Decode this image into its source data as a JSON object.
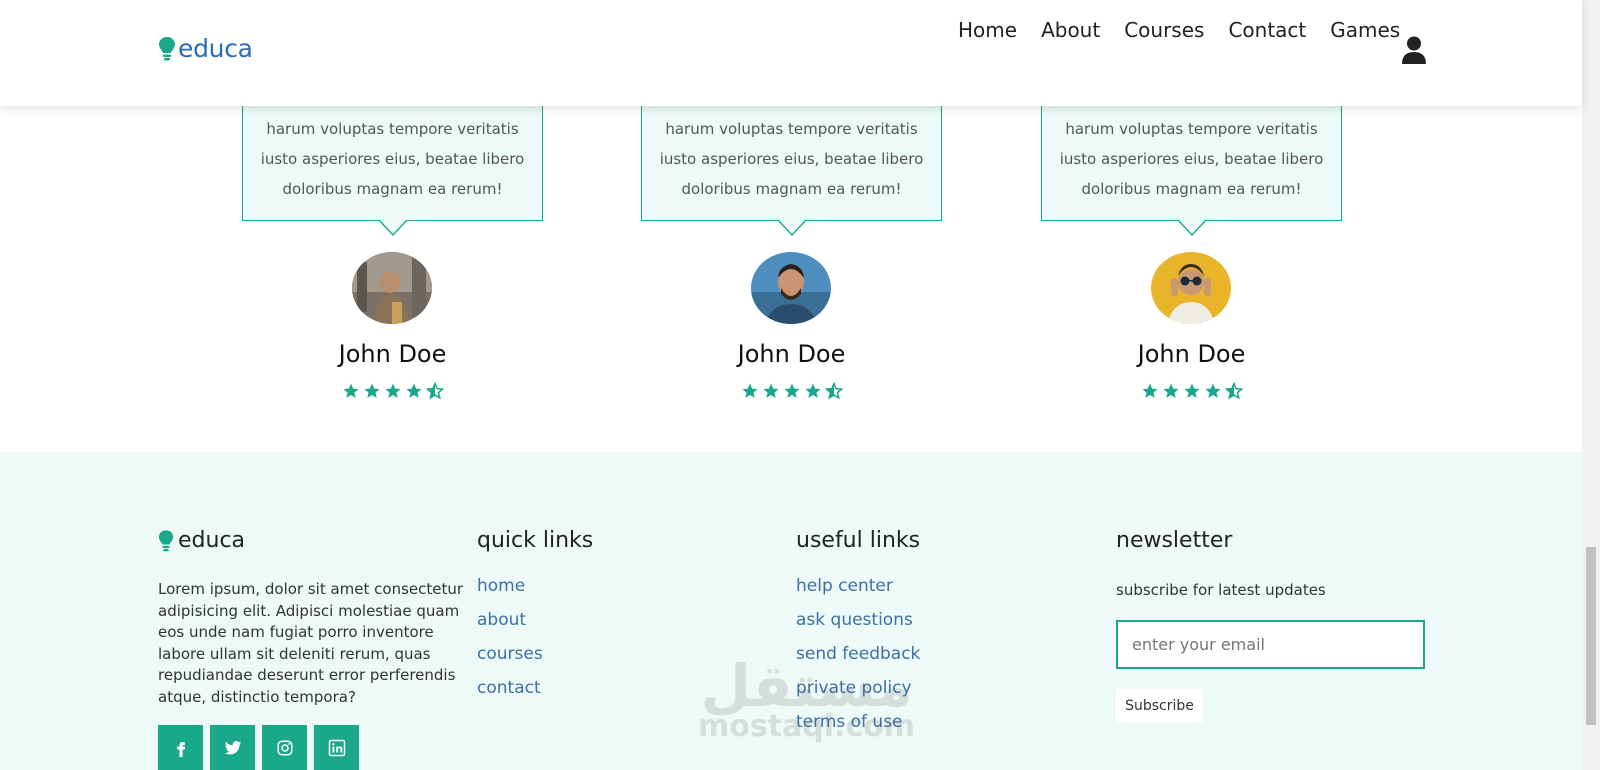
{
  "header": {
    "logo_text": "educa",
    "nav": [
      "Home",
      "About",
      "Courses",
      "Contact",
      "Games"
    ]
  },
  "testimonials": [
    {
      "text_lines": [
        "harum voluptas tempore veritatis",
        "iusto asperiores eius, beatae libero",
        "doloribus magnam ea rerum!"
      ],
      "name": "John Doe",
      "rating": 4.5
    },
    {
      "text_lines": [
        "harum voluptas tempore veritatis",
        "iusto asperiores eius, beatae libero",
        "doloribus magnam ea rerum!"
      ],
      "name": "John Doe",
      "rating": 4.5
    },
    {
      "text_lines": [
        "harum voluptas tempore veritatis",
        "iusto asperiores eius, beatae libero",
        "doloribus magnam ea rerum!"
      ],
      "name": "John Doe",
      "rating": 4.5
    }
  ],
  "footer": {
    "brand": {
      "logo_text": "educa",
      "about": "Lorem ipsum, dolor sit amet consectetur adipisicing elit. Adipisci molestiae quam eos unde nam fugiat porro inventore labore ullam sit deleniti rerum, quas repudiandae deserunt error perferendis atque, distinctio tempora?",
      "social_icons": [
        "facebook-icon",
        "twitter-icon",
        "instagram-icon",
        "linkedin-icon"
      ]
    },
    "quick_links": {
      "title": "quick links",
      "links": [
        "home",
        "about",
        "courses",
        "contact"
      ]
    },
    "useful_links": {
      "title": "useful links",
      "links": [
        "help center",
        "ask questions",
        "send feedback",
        "private policy",
        "terms of use"
      ]
    },
    "newsletter": {
      "title": "newsletter",
      "subtitle": "subscribe for latest updates",
      "placeholder": "enter your email",
      "button": "Subscribe"
    }
  },
  "watermark": {
    "arabic": "مستقل",
    "latin": "mostaql.com"
  },
  "colors": {
    "accent": "#19a889",
    "link": "#3b6fa8",
    "footer_bg": "#eefaf7",
    "logo": "#2a6db8"
  }
}
